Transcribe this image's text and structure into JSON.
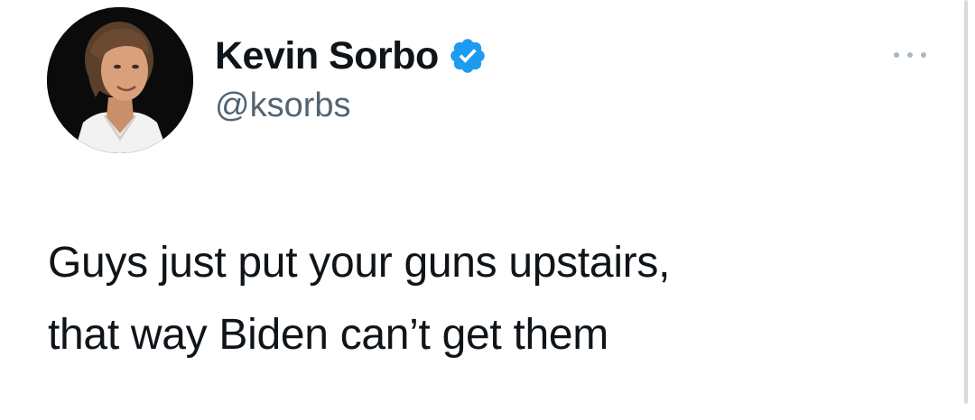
{
  "tweet": {
    "author": {
      "display_name": "Kevin Sorbo",
      "handle": "@ksorbs",
      "verified": true,
      "avatar_icon": "profile-photo"
    },
    "text_lines": [
      "Guys just put your guns upstairs,",
      "that way Biden can’t get them"
    ],
    "more_icon": "more-options-icon"
  },
  "colors": {
    "verified_blue": "#1d9bf0",
    "handle_gray": "#536471",
    "text": "#0f1419"
  }
}
